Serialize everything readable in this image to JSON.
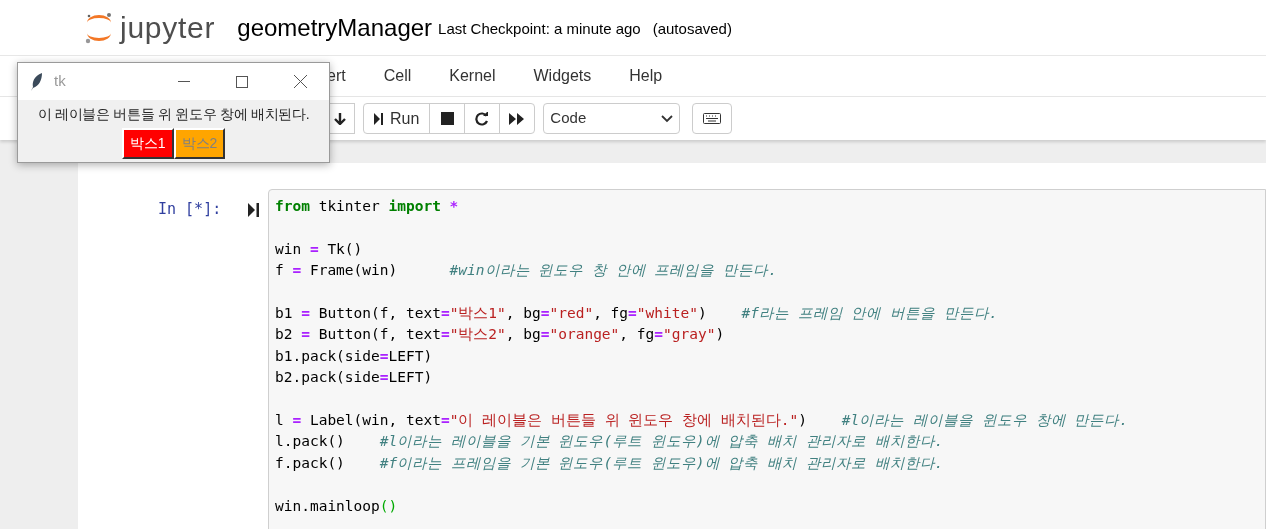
{
  "header": {
    "logo_text": "jupyter",
    "notebook_name": "geometryManager",
    "checkpoint": "Last Checkpoint: a minute ago",
    "autosave": "(autosaved)"
  },
  "menu": [
    "ert",
    "Cell",
    "Kernel",
    "Widgets",
    "Help"
  ],
  "toolbar": {
    "run_label": "Run",
    "cell_type": "Code"
  },
  "cell": {
    "prompt": "In [*]:",
    "lines": [
      {
        "kind": "code",
        "tokens": [
          {
            "kind": "kw",
            "text": "from"
          },
          {
            "kind": "plain",
            "text": " tkinter "
          },
          {
            "kind": "kw",
            "text": "import"
          },
          {
            "kind": "op",
            "text": " *"
          }
        ]
      },
      {
        "kind": "blank"
      },
      {
        "kind": "code",
        "tokens": [
          {
            "kind": "plain",
            "text": "win "
          },
          {
            "kind": "op",
            "text": "="
          },
          {
            "kind": "plain",
            "text": " Tk()"
          }
        ]
      },
      {
        "kind": "code",
        "tokens": [
          {
            "kind": "plain",
            "text": "f "
          },
          {
            "kind": "op",
            "text": "="
          },
          {
            "kind": "plain",
            "text": " Frame(win)      "
          },
          {
            "kind": "comment",
            "text": "#win이라는 윈도우 창 안에 프레임을 만든다."
          }
        ]
      },
      {
        "kind": "blank"
      },
      {
        "kind": "code",
        "tokens": [
          {
            "kind": "plain",
            "text": "b1 "
          },
          {
            "kind": "op",
            "text": "="
          },
          {
            "kind": "plain",
            "text": " Button(f, text"
          },
          {
            "kind": "op",
            "text": "="
          },
          {
            "kind": "str",
            "text": "\"박스1\""
          },
          {
            "kind": "plain",
            "text": ", bg"
          },
          {
            "kind": "op",
            "text": "="
          },
          {
            "kind": "str",
            "text": "\"red\""
          },
          {
            "kind": "plain",
            "text": ", fg"
          },
          {
            "kind": "op",
            "text": "="
          },
          {
            "kind": "str",
            "text": "\"white\""
          },
          {
            "kind": "plain",
            "text": ")    "
          },
          {
            "kind": "comment",
            "text": "#f라는 프레임 안에 버튼을 만든다."
          }
        ]
      },
      {
        "kind": "code",
        "tokens": [
          {
            "kind": "plain",
            "text": "b2 "
          },
          {
            "kind": "op",
            "text": "="
          },
          {
            "kind": "plain",
            "text": " Button(f, text"
          },
          {
            "kind": "op",
            "text": "="
          },
          {
            "kind": "str",
            "text": "\"박스2\""
          },
          {
            "kind": "plain",
            "text": ", bg"
          },
          {
            "kind": "op",
            "text": "="
          },
          {
            "kind": "str",
            "text": "\"orange\""
          },
          {
            "kind": "plain",
            "text": ", fg"
          },
          {
            "kind": "op",
            "text": "="
          },
          {
            "kind": "str",
            "text": "\"gray\""
          },
          {
            "kind": "plain",
            "text": ")"
          }
        ]
      },
      {
        "kind": "code",
        "tokens": [
          {
            "kind": "plain",
            "text": "b1.pack(side"
          },
          {
            "kind": "op",
            "text": "="
          },
          {
            "kind": "plain",
            "text": "LEFT)"
          }
        ]
      },
      {
        "kind": "code",
        "tokens": [
          {
            "kind": "plain",
            "text": "b2.pack(side"
          },
          {
            "kind": "op",
            "text": "="
          },
          {
            "kind": "plain",
            "text": "LEFT)"
          }
        ]
      },
      {
        "kind": "blank"
      },
      {
        "kind": "code",
        "tokens": [
          {
            "kind": "plain",
            "text": "l "
          },
          {
            "kind": "op",
            "text": "="
          },
          {
            "kind": "plain",
            "text": " Label(win, text"
          },
          {
            "kind": "op",
            "text": "="
          },
          {
            "kind": "str",
            "text": "\"이 레이블은 버튼들 위 윈도우 창에 배치된다.\""
          },
          {
            "kind": "plain",
            "text": ")    "
          },
          {
            "kind": "comment",
            "text": "#l이라는 레이블을 윈도우 창에 만든다."
          }
        ]
      },
      {
        "kind": "code",
        "tokens": [
          {
            "kind": "plain",
            "text": "l.pack()    "
          },
          {
            "kind": "comment",
            "text": "#l이라는 레이블을 기본 윈도우(루트 윈도우)에 압축 배치 관리자로 배치한다."
          }
        ]
      },
      {
        "kind": "code",
        "tokens": [
          {
            "kind": "plain",
            "text": "f.pack()    "
          },
          {
            "kind": "comment",
            "text": "#f이라는 프레임을 기본 윈도우(루트 윈도우)에 압축 배치 관리자로 배치한다."
          }
        ]
      },
      {
        "kind": "blank"
      },
      {
        "kind": "code",
        "tokens": [
          {
            "kind": "plain",
            "text": "win.mainloop"
          },
          {
            "kind": "bracket",
            "text": "()"
          }
        ]
      }
    ]
  },
  "tk_window": {
    "title": "tk",
    "label": "이 레이블은 버튼들 위 윈도우 창에 배치된다.",
    "buttons": [
      {
        "text": "박스1",
        "color": "#ff0000",
        "kind": "light"
      },
      {
        "text": "박스2",
        "color": "#ffa500",
        "kind": "muted"
      }
    ]
  }
}
